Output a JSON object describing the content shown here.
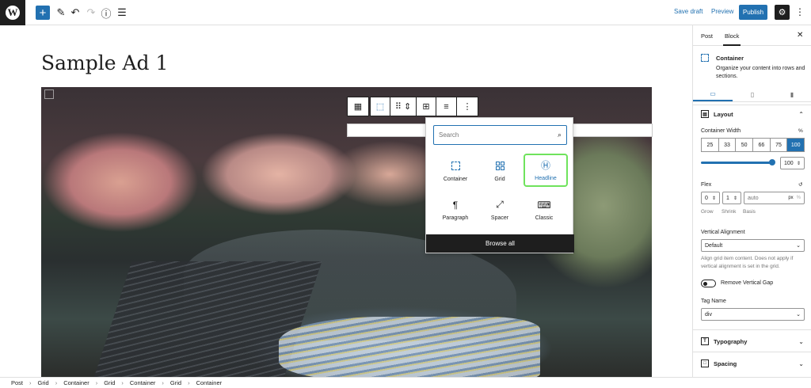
{
  "topbar": {
    "add_icon": "+",
    "save_draft": "Save draft",
    "preview": "Preview",
    "publish": "Publish"
  },
  "post": {
    "title": "Sample Ad 1"
  },
  "block_toolbar": {
    "appender_icon": "+"
  },
  "inserter": {
    "search_placeholder": "Search",
    "blocks": [
      {
        "label": "Container"
      },
      {
        "label": "Grid"
      },
      {
        "label": "Headline"
      },
      {
        "label": "Paragraph"
      },
      {
        "label": "Spacer"
      },
      {
        "label": "Classic"
      }
    ],
    "browse_all": "Browse all"
  },
  "sidebar": {
    "tabs": [
      "Post",
      "Block"
    ],
    "block": {
      "name": "Container",
      "description": "Organize your content into rows and sections."
    },
    "layout": {
      "title": "Layout",
      "container_width_label": "Container Width",
      "unit": "%",
      "width_options": [
        "25",
        "33",
        "50",
        "66",
        "75",
        "100"
      ],
      "width_value": "100",
      "flex_label": "Flex",
      "grow": "0",
      "shrink": "1",
      "basis_placeholder": "auto",
      "basis_unit": "px",
      "grow_label": "Grow",
      "shrink_label": "Shrink",
      "basis_label": "Basis",
      "vertical_alignment_label": "Vertical Alignment",
      "vertical_alignment_value": "Default",
      "vertical_alignment_help": "Align grid item content. Does not apply if vertical alignment is set in the grid.",
      "remove_vertical_gap": "Remove Vertical Gap",
      "tag_name_label": "Tag Name",
      "tag_name_value": "div"
    },
    "typography": "Typography",
    "spacing": "Spacing"
  },
  "breadcrumb": [
    "Post",
    "Grid",
    "Container",
    "Grid",
    "Container",
    "Grid",
    "Container"
  ],
  "colors": {
    "accent": "#2271b1",
    "highlight": "#6fe35c",
    "dark": "#1e1e1e"
  }
}
